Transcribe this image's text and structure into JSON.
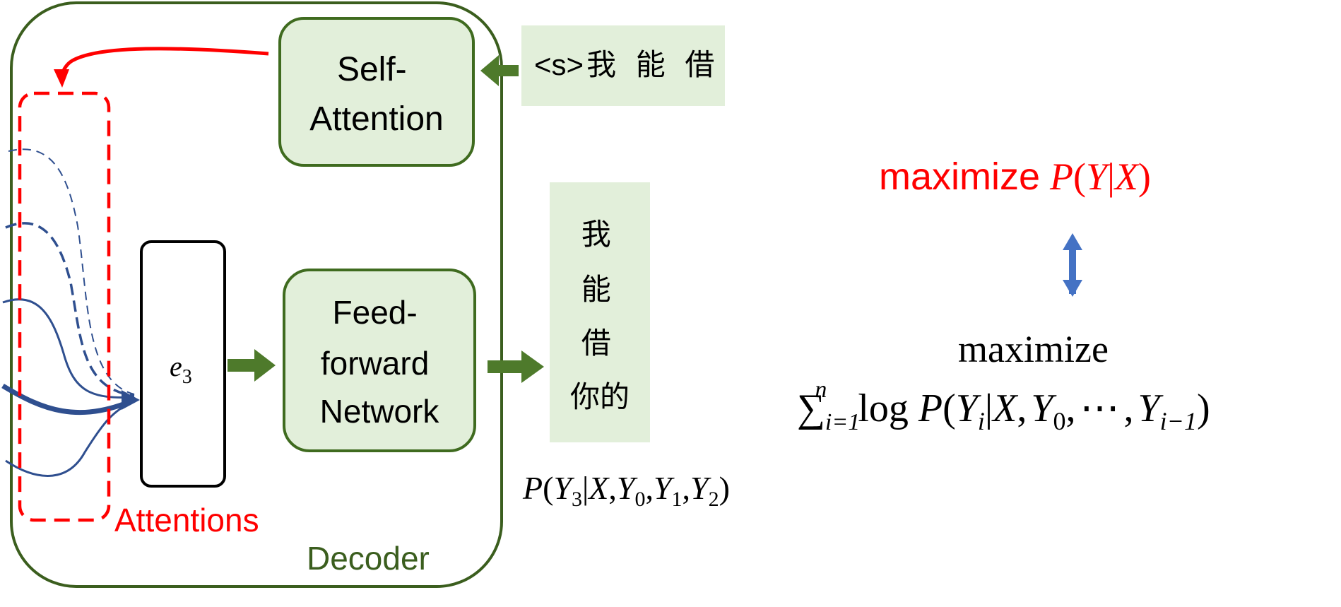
{
  "decoder": {
    "label": "Decoder",
    "self_attention": {
      "line1": "Self-",
      "line2": "Attention"
    },
    "feed_forward": {
      "line1": "Feed-",
      "line2": "forward",
      "line3": "Network"
    },
    "embedding": {
      "var": "e",
      "sub": "3"
    },
    "attentions_label": "Attentions"
  },
  "input_tokens": {
    "start": "<s>",
    "tokens": "我 能 借"
  },
  "output_tokens": [
    "我",
    "能",
    "借",
    "你的"
  ],
  "conditional_prob": {
    "p": "P",
    "open": "(",
    "y": "Y",
    "y_sub": "3",
    "bar": "|",
    "x": "X",
    "comma": ",",
    "y0_sub": "0",
    "y1_sub": "1",
    "y2_sub": "2",
    "close": ")"
  },
  "objective": {
    "word": "maximize",
    "p": "P",
    "open": "(",
    "y": "Y",
    "bar": "|",
    "x": "X",
    "close": ")"
  },
  "sum_expression": {
    "word": "maximize",
    "sigma": "∑",
    "sub": "i=1",
    "sup": "n",
    "log": "log",
    "p": "P",
    "open": "(",
    "y": "Y",
    "y_sub": "i",
    "bar": "|",
    "x": "X",
    "comma": ",",
    "y0_sub": "0",
    "dots": "⋯",
    "yn_sub": "i−1",
    "close": ")"
  },
  "colors": {
    "box_fill": "#e2efda",
    "box_stroke": "#3f6b1f",
    "decoder_stroke": "#3b5e1e",
    "decoder_label": "#3b5e1e",
    "green_arrow": "#4e7a2b",
    "red": "#ff0000",
    "blue_line": "#2f4f8f",
    "double_arrow": "#4472c4",
    "text": "#000000"
  },
  "icons": {
    "bidirectional": "double-arrow-icon",
    "flow": "arrow-right-icon"
  }
}
